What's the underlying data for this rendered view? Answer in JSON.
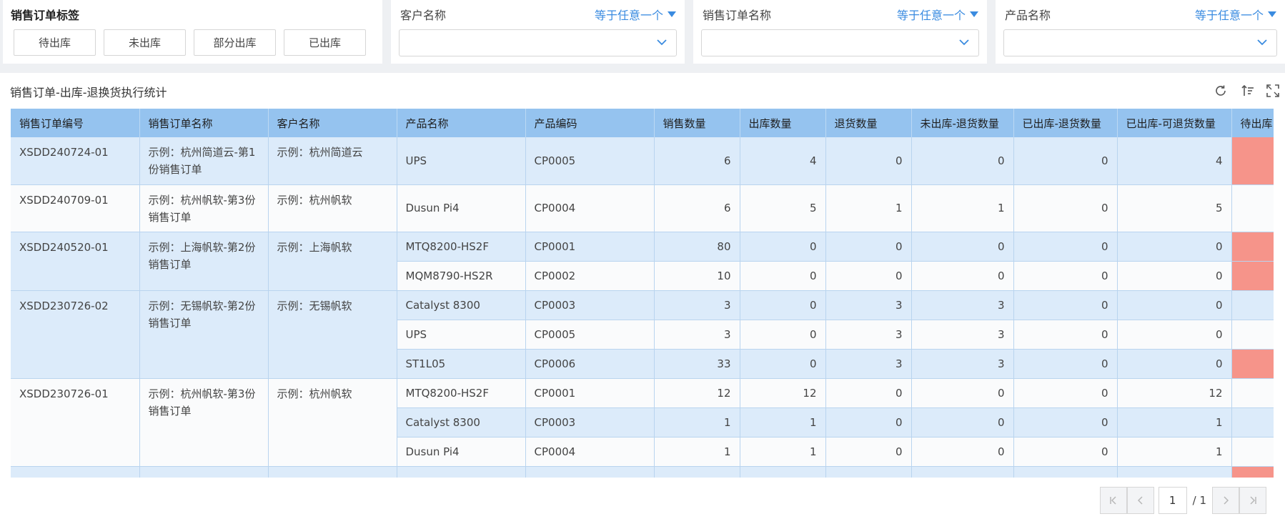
{
  "tag_filter": {
    "title": "销售订单标签",
    "tags": [
      "待出库",
      "未出库",
      "部分出库",
      "已出库"
    ]
  },
  "filters": [
    {
      "label": "客户名称",
      "operator": "等于任意一个",
      "value": ""
    },
    {
      "label": "销售订单名称",
      "operator": "等于任意一个",
      "value": ""
    },
    {
      "label": "产品名称",
      "operator": "等于任意一个",
      "value": ""
    }
  ],
  "report": {
    "title": "销售订单-出库-退换货执行统计",
    "icons": [
      "refresh-icon",
      "sort-icon",
      "fullscreen-icon"
    ]
  },
  "table": {
    "headers": [
      "销售订单编号",
      "销售订单名称",
      "客户名称",
      "产品名称",
      "产品编码",
      "销售数量",
      "出库数量",
      "退货数量",
      "未出库-退货数量",
      "已出库-退货数量",
      "已出库-可退货数量",
      "待出库"
    ],
    "orders": [
      {
        "order_no": "XSDD240724-01",
        "order_name": "示例：杭州简道云-第1份销售订单",
        "customer": "示例：杭州简道云",
        "items": [
          {
            "product": "UPS",
            "code": "CP0005",
            "sales_qty": "6",
            "out_qty": "4",
            "return_qty": "0",
            "not_out_return": "0",
            "out_return": "0",
            "out_returnable": "4",
            "pending_flag": true
          }
        ]
      },
      {
        "order_no": "XSDD240709-01",
        "order_name": "示例：杭州帆软-第3份销售订单",
        "customer": "示例：杭州帆软",
        "items": [
          {
            "product": "Dusun Pi4",
            "code": "CP0004",
            "sales_qty": "6",
            "out_qty": "5",
            "return_qty": "1",
            "not_out_return": "1",
            "out_return": "0",
            "out_returnable": "5",
            "pending_flag": false
          }
        ]
      },
      {
        "order_no": "XSDD240520-01",
        "order_name": "示例：上海帆软-第2份销售订单",
        "customer": "示例：上海帆软",
        "items": [
          {
            "product": "MTQ8200-HS2F",
            "code": "CP0001",
            "sales_qty": "80",
            "out_qty": "0",
            "return_qty": "0",
            "not_out_return": "0",
            "out_return": "0",
            "out_returnable": "0",
            "pending_flag": true
          },
          {
            "product": "MQM8790-HS2R",
            "code": "CP0002",
            "sales_qty": "10",
            "out_qty": "0",
            "return_qty": "0",
            "not_out_return": "0",
            "out_return": "0",
            "out_returnable": "0",
            "pending_flag": true
          }
        ]
      },
      {
        "order_no": "XSDD230726-02",
        "order_name": "示例：无锡帆软-第2份销售订单",
        "customer": "示例：无锡帆软",
        "items": [
          {
            "product": "Catalyst 8300",
            "code": "CP0003",
            "sales_qty": "3",
            "out_qty": "0",
            "return_qty": "3",
            "not_out_return": "3",
            "out_return": "0",
            "out_returnable": "0",
            "pending_flag": false
          },
          {
            "product": "UPS",
            "code": "CP0005",
            "sales_qty": "3",
            "out_qty": "0",
            "return_qty": "3",
            "not_out_return": "3",
            "out_return": "0",
            "out_returnable": "0",
            "pending_flag": false
          },
          {
            "product": "ST1L05",
            "code": "CP0006",
            "sales_qty": "33",
            "out_qty": "0",
            "return_qty": "3",
            "not_out_return": "3",
            "out_return": "0",
            "out_returnable": "0",
            "pending_flag": true
          }
        ]
      },
      {
        "order_no": "XSDD230726-01",
        "order_name": "示例：杭州帆软-第3份销售订单",
        "customer": "示例：杭州帆软",
        "items": [
          {
            "product": "MTQ8200-HS2F",
            "code": "CP0001",
            "sales_qty": "12",
            "out_qty": "12",
            "return_qty": "0",
            "not_out_return": "0",
            "out_return": "0",
            "out_returnable": "12",
            "pending_flag": false
          },
          {
            "product": "Catalyst 8300",
            "code": "CP0003",
            "sales_qty": "1",
            "out_qty": "1",
            "return_qty": "0",
            "not_out_return": "0",
            "out_return": "0",
            "out_returnable": "1",
            "pending_flag": false
          },
          {
            "product": "Dusun Pi4",
            "code": "CP0004",
            "sales_qty": "1",
            "out_qty": "1",
            "return_qty": "0",
            "not_out_return": "0",
            "out_return": "0",
            "out_returnable": "1",
            "pending_flag": false
          }
        ]
      }
    ]
  },
  "pagination": {
    "current_page": "1",
    "total_pages": "/ 1"
  },
  "colors": {
    "accent": "#3a8be0",
    "header_bg": "#95c3ef",
    "row_odd": "#dcebfa",
    "row_even": "#fafbfc",
    "pending_highlight": "#f6948a"
  }
}
